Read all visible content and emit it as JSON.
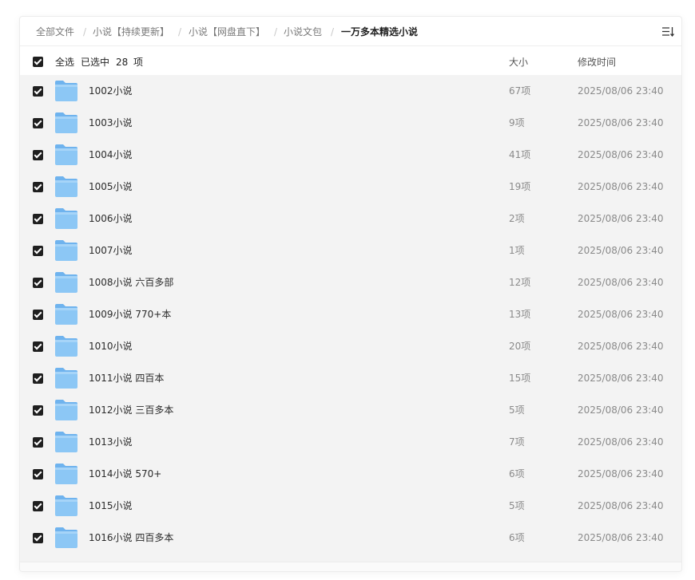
{
  "breadcrumb": {
    "items": [
      "全部文件",
      "小说【持续更新】",
      "小说【网盘直下】",
      "小说文包",
      "一万多本精选小说"
    ],
    "separator": "/"
  },
  "header": {
    "select_all": "全选",
    "selected_prefix": "已选中",
    "selected_count": "28",
    "selected_unit": "项",
    "col_size": "大小",
    "col_modified": "修改时间"
  },
  "icons": {
    "sort": "sort-icon",
    "folder": "folder-icon",
    "checkbox": "checked-checkbox"
  },
  "colors": {
    "folder": "#8cc7f5",
    "row_bg": "#f3f3f3",
    "checkbox": "#1f1f1f"
  },
  "rows": [
    {
      "name": "1002小说",
      "size": "67项",
      "modified": "2025/08/06 23:40",
      "checked": true
    },
    {
      "name": "1003小说",
      "size": "9项",
      "modified": "2025/08/06 23:40",
      "checked": true
    },
    {
      "name": "1004小说",
      "size": "41项",
      "modified": "2025/08/06 23:40",
      "checked": true
    },
    {
      "name": "1005小说",
      "size": "19项",
      "modified": "2025/08/06 23:40",
      "checked": true
    },
    {
      "name": "1006小说",
      "size": "2项",
      "modified": "2025/08/06 23:40",
      "checked": true
    },
    {
      "name": "1007小说",
      "size": "1项",
      "modified": "2025/08/06 23:40",
      "checked": true
    },
    {
      "name": "1008小说 六百多部",
      "size": "12项",
      "modified": "2025/08/06 23:40",
      "checked": true
    },
    {
      "name": "1009小说 770+本",
      "size": "13项",
      "modified": "2025/08/06 23:40",
      "checked": true
    },
    {
      "name": "1010小说",
      "size": "20项",
      "modified": "2025/08/06 23:40",
      "checked": true
    },
    {
      "name": "1011小说 四百本",
      "size": "15项",
      "modified": "2025/08/06 23:40",
      "checked": true
    },
    {
      "name": "1012小说 三百多本",
      "size": "5项",
      "modified": "2025/08/06 23:40",
      "checked": true
    },
    {
      "name": "1013小说",
      "size": "7项",
      "modified": "2025/08/06 23:40",
      "checked": true
    },
    {
      "name": "1014小说 570+",
      "size": "6项",
      "modified": "2025/08/06 23:40",
      "checked": true
    },
    {
      "name": "1015小说",
      "size": "5项",
      "modified": "2025/08/06 23:40",
      "checked": true
    },
    {
      "name": "1016小说 四百多本",
      "size": "6项",
      "modified": "2025/08/06 23:40",
      "checked": true
    }
  ]
}
